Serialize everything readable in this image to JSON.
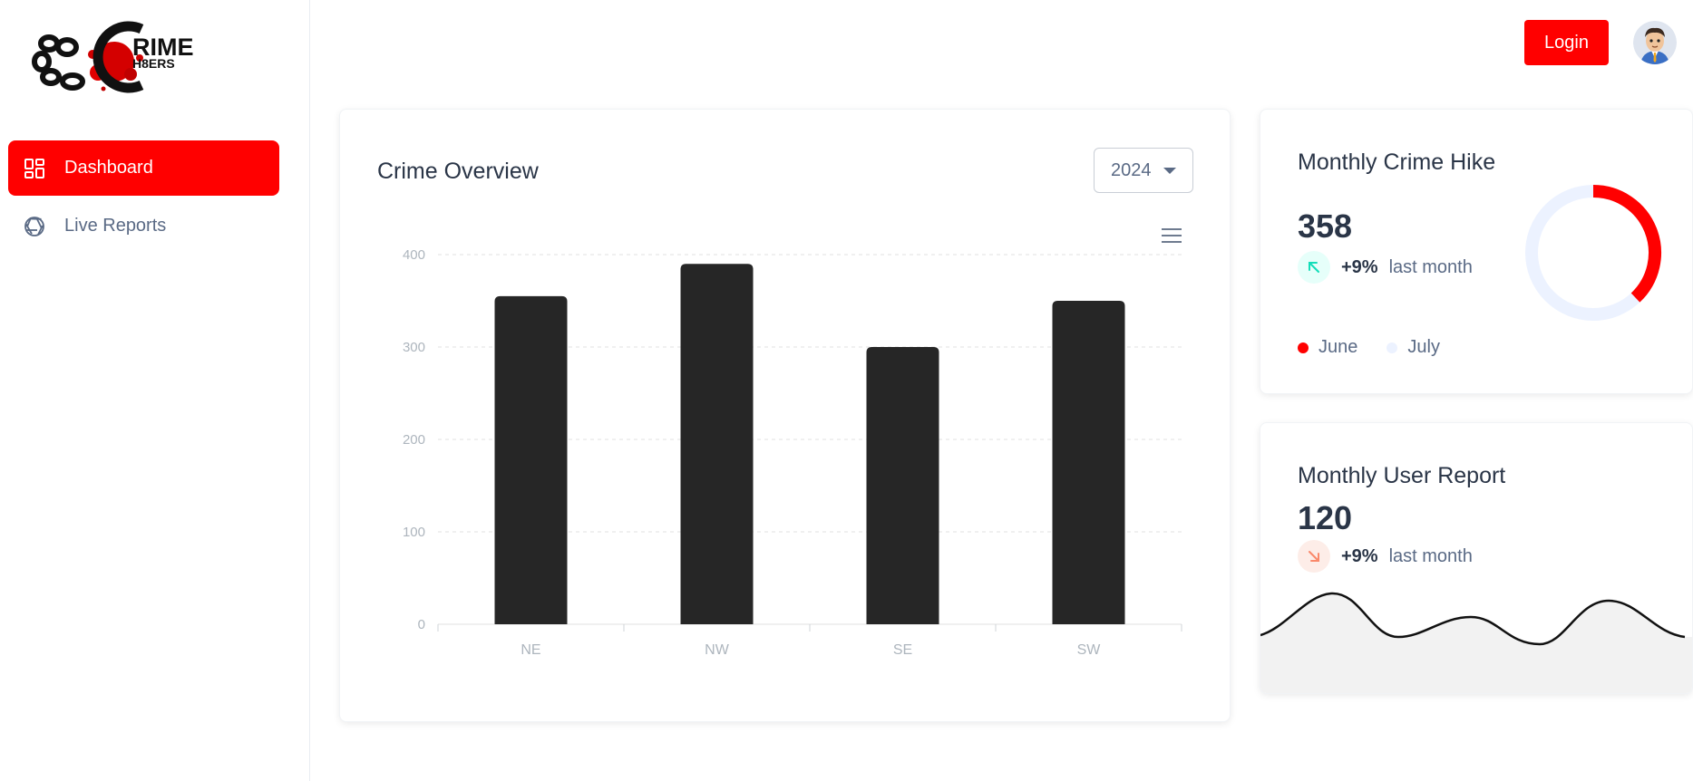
{
  "sidebar": {
    "logo_text_1": "CRIME",
    "logo_text_2": "H8ERS",
    "items": [
      {
        "label": "Dashboard",
        "icon": "dashboard-icon",
        "active": true
      },
      {
        "label": "Live Reports",
        "icon": "aperture-icon",
        "active": false
      }
    ]
  },
  "header": {
    "login_label": "Login",
    "avatar": "user-avatar"
  },
  "overview": {
    "title": "Crime Overview",
    "year": "2024"
  },
  "hike": {
    "title": "Monthly Crime Hike",
    "value": "358",
    "pct": "+9%",
    "period": "last month",
    "legend": [
      {
        "label": "June",
        "color": "#ff0000"
      },
      {
        "label": "July",
        "color": "#ecf2ff"
      }
    ],
    "donut_share": 0.38
  },
  "users": {
    "title": "Monthly User Report",
    "value": "120",
    "pct": "+9%",
    "period": "last month"
  },
  "colors": {
    "accent": "#ff0000",
    "bar": "#262626",
    "up_bg": "#e6fffa",
    "up_fg": "#13deb9",
    "down_bg": "#fdede8",
    "down_fg": "#fa896b"
  },
  "chart_data": {
    "type": "bar",
    "categories": [
      "NE",
      "NW",
      "SE",
      "SW"
    ],
    "values": [
      355,
      390,
      300,
      350
    ],
    "ylim": [
      0,
      400
    ],
    "yticks": [
      "0",
      "100",
      "200",
      "300",
      "400"
    ],
    "grid": true,
    "title": "",
    "xlabel": "",
    "ylabel": ""
  }
}
